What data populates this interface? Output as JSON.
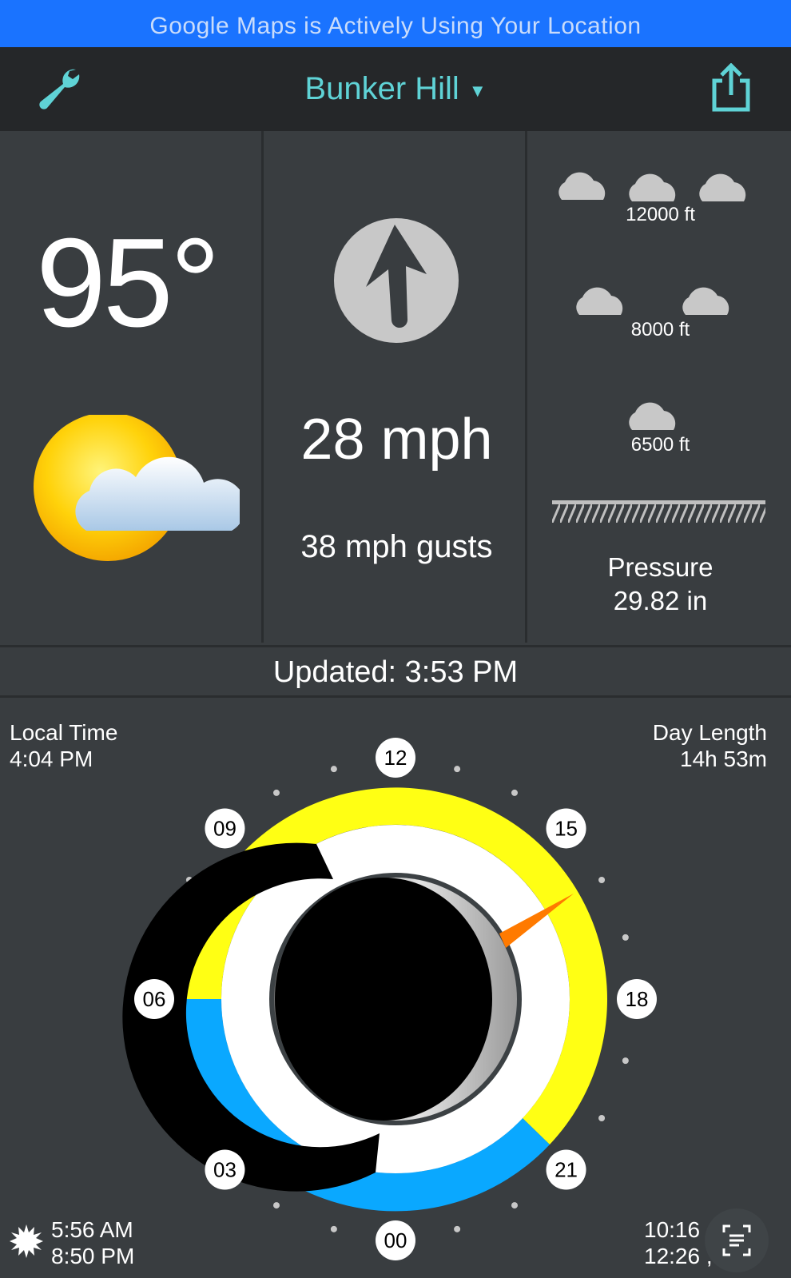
{
  "status_banner": "Google Maps is Actively Using Your Location",
  "header": {
    "location": "Bunker Hill",
    "caret": "▼"
  },
  "temperature": {
    "value": "95°",
    "condition_icon": "partly-cloudy-icon"
  },
  "wind": {
    "speed": "28 mph",
    "gusts": "38 mph gusts",
    "direction_icon": "wind-arrow-icon"
  },
  "clouds": {
    "layers": [
      "12000 ft",
      "8000 ft",
      "6500 ft"
    ]
  },
  "pressure": {
    "label": "Pressure",
    "value": "29.82 in"
  },
  "updated": "Updated:  3:53 PM",
  "local_time": {
    "label": "Local Time",
    "value": "4:04 PM"
  },
  "day_length": {
    "label": "Day Length",
    "value": "14h 53m"
  },
  "sun": {
    "rise": "5:56 AM",
    "set": "8:50 PM"
  },
  "moon": {
    "rise": "10:16",
    "set": "12:26 ,"
  },
  "clock": {
    "hours": [
      "12",
      "15",
      "18",
      "21",
      "00",
      "03",
      "06",
      "09"
    ]
  },
  "colors": {
    "accent": "#5fd3d6",
    "banner": "#1a73ff",
    "day": "#ffff14",
    "night": "#0aa8ff",
    "background": "#393d40",
    "hand": "#ff7a00"
  }
}
